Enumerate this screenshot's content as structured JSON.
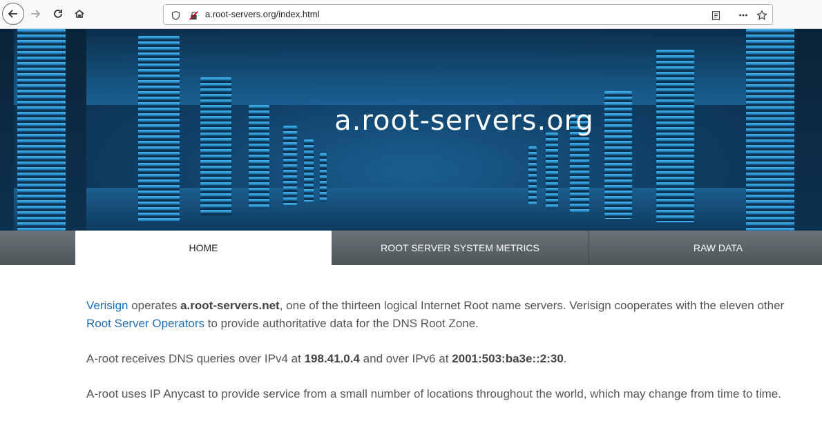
{
  "browser": {
    "url": "a.root-servers.org/index.html"
  },
  "hero": {
    "title": "a.root-servers.org"
  },
  "nav": {
    "tabs": [
      {
        "label": "HOME"
      },
      {
        "label": "ROOT SERVER SYSTEM METRICS"
      },
      {
        "label": "RAW DATA"
      }
    ]
  },
  "content": {
    "p1": {
      "link1": "Verisign",
      "text1": " operates ",
      "bold1": "a.root-servers.net",
      "text2": ", one of the thirteen logical Internet Root name servers. Verisign cooperates with the eleven other ",
      "link2": "Root Server Operators",
      "text3": " to provide authoritative data for the DNS Root Zone."
    },
    "p2": {
      "text1": "A-root receives DNS queries over IPv4 at ",
      "bold1": "198.41.0.4",
      "text2": " and over IPv6 at ",
      "bold2": "2001:503:ba3e::2:30",
      "text3": "."
    },
    "p3": {
      "text1": "A-root uses IP Anycast to provide service from a small number of locations throughout the world, which may change from time to time."
    }
  }
}
